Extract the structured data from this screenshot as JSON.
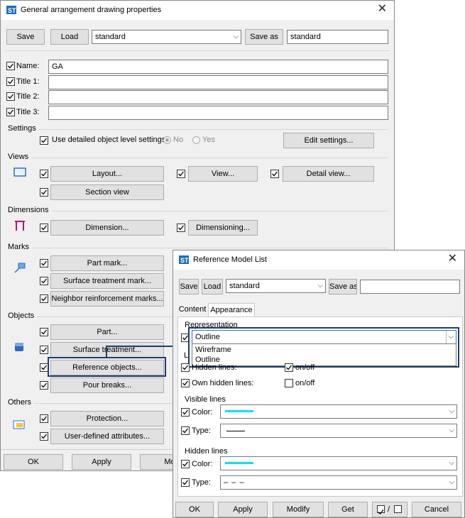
{
  "main": {
    "title": "General arrangement drawing properties",
    "toolbar": {
      "save": "Save",
      "load": "Load",
      "preset": "standard",
      "save_as": "Save as",
      "save_as_value": "standard"
    },
    "fields": [
      {
        "label": "Name:",
        "value": "GA"
      },
      {
        "label": "Title 1:",
        "value": ""
      },
      {
        "label": "Title 2:",
        "value": ""
      },
      {
        "label": "Title 3:",
        "value": ""
      }
    ],
    "settings": {
      "header": "Settings",
      "use_detailed": "Use detailed object level settings",
      "no": "No",
      "yes": "Yes",
      "edit": "Edit settings..."
    },
    "views": {
      "header": "Views",
      "layout": "Layout...",
      "view": "View...",
      "detail_view": "Detail view...",
      "section_view": "Section view"
    },
    "dimensions": {
      "header": "Dimensions",
      "dimension": "Dimension...",
      "dimensioning": "Dimensioning..."
    },
    "marks": {
      "header": "Marks",
      "part_mark": "Part mark...",
      "surface_mark": "Surface treatment mark...",
      "neighbor_marks": "Neighbor reinforcement marks..."
    },
    "objects": {
      "header": "Objects",
      "part": "Part...",
      "surface": "Surface treatment...",
      "reference": "Reference objects...",
      "pour": "Pour breaks..."
    },
    "others": {
      "header": "Others",
      "protection": "Protection...",
      "uda": "User-defined attributes..."
    },
    "footer": {
      "ok": "OK",
      "apply": "Apply",
      "modify": "Mo"
    }
  },
  "ref": {
    "title": "Reference Model List",
    "toolbar": {
      "save": "Save",
      "load": "Load",
      "preset": "standard",
      "save_as": "Save as",
      "save_as_value": ""
    },
    "tabs": [
      "Content",
      "Appearance"
    ],
    "representation": {
      "header": "Representation",
      "selected": "Outline",
      "options": [
        "Wireframe",
        "Outline"
      ]
    },
    "line_partial": "L",
    "hidden_lines_label": "Hidden lines:",
    "onoff1": "on/off",
    "own_hidden": "Own hidden lines:",
    "onoff2": "on/off",
    "visible_lines": {
      "header": "Visible lines",
      "color": "Color:",
      "type": "Type:",
      "color_hex": "#00e5f0"
    },
    "hidden_lines": {
      "header": "Hidden lines",
      "color": "Color:",
      "type": "Type:",
      "color_hex": "#00e5f0",
      "type_value": "– – –"
    },
    "footer": {
      "ok": "OK",
      "apply": "Apply",
      "modify": "Modify",
      "get": "Get",
      "cancel": "Cancel"
    }
  },
  "colors": {
    "accent_border": "#1f3c6e",
    "line_color": "#00e5f0",
    "app_icon": "#1d6fb8"
  }
}
